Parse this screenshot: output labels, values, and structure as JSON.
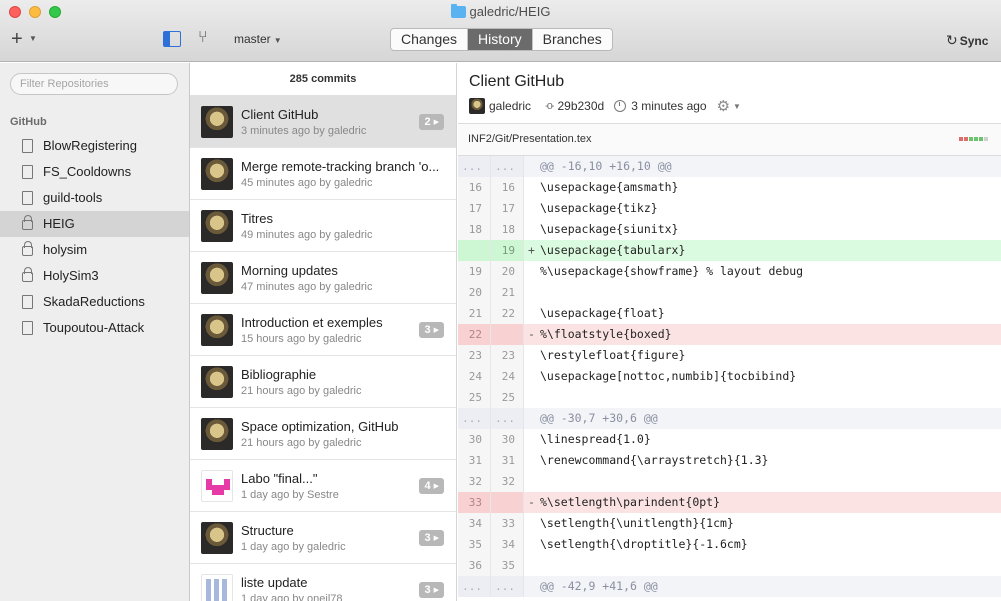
{
  "window": {
    "title": "galedric/HEIG"
  },
  "toolbar": {
    "add_icon": "+",
    "branch_name": "master",
    "tabs": [
      {
        "label": "Changes",
        "active": false
      },
      {
        "label": "History",
        "active": true
      },
      {
        "label": "Branches",
        "active": false
      }
    ],
    "sync_label": "Sync"
  },
  "sidebar": {
    "filter_placeholder": "Filter Repositories",
    "section": "GitHub",
    "repos": [
      {
        "name": "BlowRegistering",
        "icon": "repo-icon",
        "selected": false
      },
      {
        "name": "FS_Cooldowns",
        "icon": "repo-icon",
        "selected": false
      },
      {
        "name": "guild-tools",
        "icon": "repo-icon",
        "selected": false
      },
      {
        "name": "HEIG",
        "icon": "lock-icon",
        "selected": true
      },
      {
        "name": "holysim",
        "icon": "lock-icon",
        "selected": false
      },
      {
        "name": "HolySim3",
        "icon": "lock-icon",
        "selected": false
      },
      {
        "name": "SkadaReductions",
        "icon": "repo-icon",
        "selected": false
      },
      {
        "name": "Toupoutou-Attack",
        "icon": "repo-icon",
        "selected": false
      }
    ]
  },
  "commits": {
    "count_label": "285 commits",
    "items": [
      {
        "title": "Client GitHub",
        "meta": "3 minutes ago by galedric",
        "badge": "2",
        "avatar": "galedric",
        "selected": true
      },
      {
        "title": "Merge remote-tracking branch 'o...",
        "meta": "45 minutes ago by galedric",
        "badge": "",
        "avatar": "galedric",
        "selected": false
      },
      {
        "title": "Titres",
        "meta": "49 minutes ago by galedric",
        "badge": "",
        "avatar": "galedric",
        "selected": false
      },
      {
        "title": "Morning updates",
        "meta": "47 minutes ago by galedric",
        "badge": "",
        "avatar": "galedric",
        "selected": false
      },
      {
        "title": "Introduction et exemples",
        "meta": "15 hours ago by galedric",
        "badge": "3",
        "avatar": "galedric",
        "selected": false
      },
      {
        "title": "Bibliographie",
        "meta": "21 hours ago by galedric",
        "badge": "",
        "avatar": "galedric",
        "selected": false
      },
      {
        "title": "Space optimization, GitHub",
        "meta": "21 hours ago by galedric",
        "badge": "",
        "avatar": "galedric",
        "selected": false
      },
      {
        "title": "Labo \"final...\"",
        "meta": "1 day ago by Sestre",
        "badge": "4",
        "avatar": "pink",
        "selected": false
      },
      {
        "title": "Structure",
        "meta": "1 day ago by galedric",
        "badge": "3",
        "avatar": "galedric",
        "selected": false
      },
      {
        "title": "liste update",
        "meta": "1 day ago by oneil78",
        "badge": "3",
        "avatar": "grid",
        "selected": false
      }
    ]
  },
  "detail": {
    "title": "Client GitHub",
    "author": "galedric",
    "sha": "29b230d",
    "time": "3 minutes ago",
    "file": "INF2/Git/Presentation.tex",
    "file_stat_colors": [
      "#e06b6b",
      "#e06b6b",
      "#6bc46b",
      "#6bc46b",
      "#6bc46b",
      "#cfcfcf"
    ],
    "diff": [
      {
        "type": "hunk",
        "old": "...",
        "new": "...",
        "mark": "",
        "text": "@@ -16,10 +16,10 @@"
      },
      {
        "type": "ctx",
        "old": "16",
        "new": "16",
        "mark": "",
        "text": "\\usepackage{amsmath}"
      },
      {
        "type": "ctx",
        "old": "17",
        "new": "17",
        "mark": "",
        "text": "\\usepackage{tikz}"
      },
      {
        "type": "ctx",
        "old": "18",
        "new": "18",
        "mark": "",
        "text": "\\usepackage{siunitx}"
      },
      {
        "type": "add",
        "old": "",
        "new": "19",
        "mark": "+",
        "text": "\\usepackage{tabularx}"
      },
      {
        "type": "ctx",
        "old": "19",
        "new": "20",
        "mark": "",
        "text": "%\\usepackage{showframe} % layout debug"
      },
      {
        "type": "ctx",
        "old": "20",
        "new": "21",
        "mark": "",
        "text": ""
      },
      {
        "type": "ctx",
        "old": "21",
        "new": "22",
        "mark": "",
        "text": "\\usepackage{float}"
      },
      {
        "type": "del",
        "old": "22",
        "new": "",
        "mark": "-",
        "text": "%\\floatstyle{boxed}"
      },
      {
        "type": "ctx",
        "old": "23",
        "new": "23",
        "mark": "",
        "text": "\\restylefloat{figure}"
      },
      {
        "type": "ctx",
        "old": "24",
        "new": "24",
        "mark": "",
        "text": "\\usepackage[nottoc,numbib]{tocbibind}"
      },
      {
        "type": "ctx",
        "old": "25",
        "new": "25",
        "mark": "",
        "text": ""
      },
      {
        "type": "hunk",
        "old": "...",
        "new": "...",
        "mark": "",
        "text": "@@ -30,7 +30,6 @@"
      },
      {
        "type": "ctx",
        "old": "30",
        "new": "30",
        "mark": "",
        "text": "\\linespread{1.0}"
      },
      {
        "type": "ctx",
        "old": "31",
        "new": "31",
        "mark": "",
        "text": "\\renewcommand{\\arraystretch}{1.3}"
      },
      {
        "type": "ctx",
        "old": "32",
        "new": "32",
        "mark": "",
        "text": ""
      },
      {
        "type": "del",
        "old": "33",
        "new": "",
        "mark": "-",
        "text": "%\\setlength\\parindent{0pt}"
      },
      {
        "type": "ctx",
        "old": "34",
        "new": "33",
        "mark": "",
        "text": "\\setlength{\\unitlength}{1cm}"
      },
      {
        "type": "ctx",
        "old": "35",
        "new": "34",
        "mark": "",
        "text": "\\setlength{\\droptitle}{-1.6cm}"
      },
      {
        "type": "ctx",
        "old": "36",
        "new": "35",
        "mark": "",
        "text": ""
      },
      {
        "type": "hunk",
        "old": "...",
        "new": "...",
        "mark": "",
        "text": "@@ -42,9 +41,6 @@"
      }
    ]
  }
}
